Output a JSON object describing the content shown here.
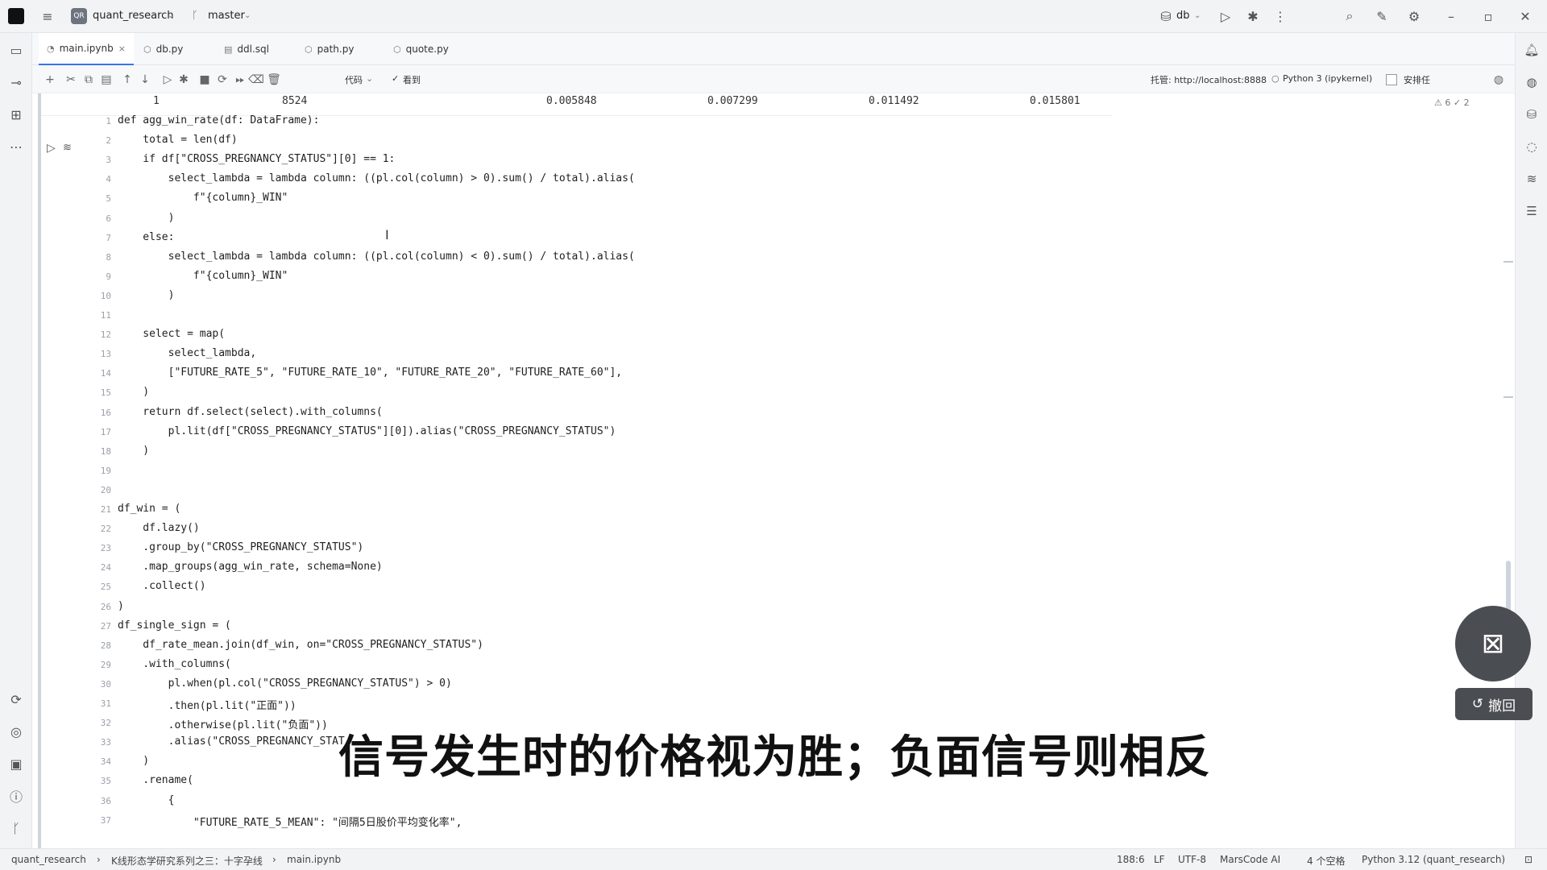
{
  "titlebar": {
    "project_badge": "QR",
    "project_name": "quant_research",
    "branch": "master",
    "run_config": "db"
  },
  "tabs": [
    {
      "label": "main.ipynb",
      "icon": "notebook-icon"
    },
    {
      "label": "db.py",
      "icon": "python-file-icon"
    },
    {
      "label": "ddl.sql",
      "icon": "sql-file-icon"
    },
    {
      "label": "path.py",
      "icon": "python-file-icon"
    },
    {
      "label": "quote.py",
      "icon": "python-file-icon"
    }
  ],
  "nbtoolbar": {
    "cell_type": "代码",
    "trusted": "看到",
    "server_label": "托管: http://localhost:8888",
    "kernel": "Python 3 (ipykernel)",
    "checkbox_label": "安排任",
    "warnings": "6",
    "checks": "2"
  },
  "output_row": {
    "index": "1",
    "values": [
      "8524",
      "0.005848",
      "0.007299",
      "0.011492",
      "0.015801"
    ]
  },
  "code": [
    {
      "n": "1",
      "text": "def agg_win_rate(df: DataFrame):"
    },
    {
      "n": "2",
      "text": "    total = len(df)"
    },
    {
      "n": "3",
      "text": "    if df[\"CROSS_PREGNANCY_STATUS\"][0] == 1:"
    },
    {
      "n": "4",
      "text": "        select_lambda = lambda column: ((pl.col(column) > 0).sum() / total).alias("
    },
    {
      "n": "5",
      "text": "            f\"{column}_WIN\""
    },
    {
      "n": "6",
      "text": "        )"
    },
    {
      "n": "7",
      "text": "    else:"
    },
    {
      "n": "8",
      "text": "        select_lambda = lambda column: ((pl.col(column) < 0).sum() / total).alias("
    },
    {
      "n": "9",
      "text": "            f\"{column}_WIN\""
    },
    {
      "n": "10",
      "text": "        )"
    },
    {
      "n": "11",
      "text": ""
    },
    {
      "n": "12",
      "text": "    select = map("
    },
    {
      "n": "13",
      "text": "        select_lambda,"
    },
    {
      "n": "14",
      "text": "        [\"FUTURE_RATE_5\", \"FUTURE_RATE_10\", \"FUTURE_RATE_20\", \"FUTURE_RATE_60\"],"
    },
    {
      "n": "15",
      "text": "    )"
    },
    {
      "n": "16",
      "text": "    return df.select(select).with_columns("
    },
    {
      "n": "17",
      "text": "        pl.lit(df[\"CROSS_PREGNANCY_STATUS\"][0]).alias(\"CROSS_PREGNANCY_STATUS\")"
    },
    {
      "n": "18",
      "text": "    )"
    },
    {
      "n": "19",
      "text": ""
    },
    {
      "n": "20",
      "text": ""
    },
    {
      "n": "21",
      "text": "df_win = ("
    },
    {
      "n": "22",
      "text": "    df.lazy()"
    },
    {
      "n": "23",
      "text": "    .group_by(\"CROSS_PREGNANCY_STATUS\")"
    },
    {
      "n": "24",
      "text": "    .map_groups(agg_win_rate, schema=None)"
    },
    {
      "n": "25",
      "text": "    .collect()"
    },
    {
      "n": "26",
      "text": ")"
    },
    {
      "n": "27",
      "text": "df_single_sign = ("
    },
    {
      "n": "28",
      "text": "    df_rate_mean.join(df_win, on=\"CROSS_PREGNANCY_STATUS\")"
    },
    {
      "n": "29",
      "text": "    .with_columns("
    },
    {
      "n": "30",
      "text": "        pl.when(pl.col(\"CROSS_PREGNANCY_STATUS\") > 0)"
    },
    {
      "n": "31",
      "text": "        .then(pl.lit(\"正面\"))"
    },
    {
      "n": "32",
      "text": "        .otherwise(pl.lit(\"负面\"))"
    },
    {
      "n": "33",
      "text": "        .alias(\"CROSS_PREGNANCY_STAT"
    },
    {
      "n": "34",
      "text": "    )"
    },
    {
      "n": "35",
      "text": "    .rename("
    },
    {
      "n": "36",
      "text": "        {"
    },
    {
      "n": "37",
      "text": "            \"FUTURE_RATE_5_MEAN\": \"间隔5日股价平均变化率\","
    }
  ],
  "subtitle": "信号发生时的价格视为胜；负面信号则相反",
  "undo_label": "撤回",
  "statusbar": {
    "crumb_project": "quant_research",
    "crumb_folder": "K线形态学研究系列之三：十字孕线",
    "crumb_file": "main.ipynb",
    "position": "188:6",
    "line_sep": "LF",
    "encoding": "UTF-8",
    "ai_plugin": "MarsCode AI",
    "indent": "4 个空格",
    "interpreter": "Python 3.12 (quant_research)"
  },
  "colors": {
    "accent": "#3574f0",
    "keyword": "#0033b3",
    "string": "#067d17"
  }
}
